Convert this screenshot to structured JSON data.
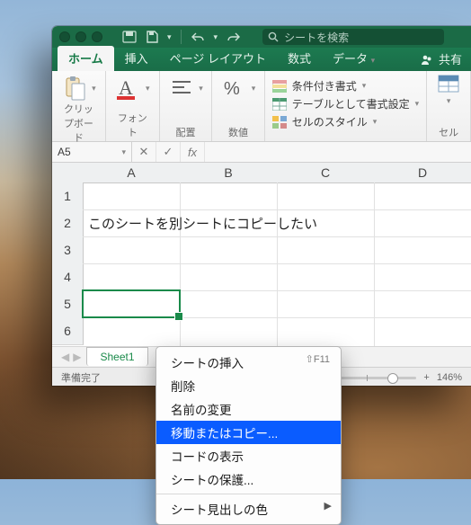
{
  "titlebar": {
    "search_placeholder": "シートを検索"
  },
  "tabs": {
    "home": "ホーム",
    "insert": "挿入",
    "page_layout": "ページ レイアウト",
    "formulas": "数式",
    "data": "データ",
    "share": "共有"
  },
  "ribbon": {
    "clipboard": "クリップボード",
    "font": "フォント",
    "alignment": "配置",
    "number": "数値",
    "conditional_format": "条件付き書式",
    "format_as_table": "テーブルとして書式設定",
    "cell_styles": "セルのスタイル",
    "cells": "セル"
  },
  "namebox": "A5",
  "columns": [
    "A",
    "B",
    "C",
    "D"
  ],
  "rows": [
    "1",
    "2",
    "3",
    "4",
    "5",
    "6"
  ],
  "cells": {
    "a2": "このシートを別シートにコピーしたい"
  },
  "sheet": {
    "name": "Sheet1"
  },
  "status": {
    "ready": "準備完了",
    "zoom": "146%"
  },
  "context_menu": {
    "insert_sheet": "シートの挿入",
    "insert_sheet_key": "⇧F11",
    "delete": "削除",
    "rename": "名前の変更",
    "move_or_copy": "移動またはコピー...",
    "view_code": "コードの表示",
    "protect_sheet": "シートの保護...",
    "tab_color": "シート見出しの色"
  }
}
